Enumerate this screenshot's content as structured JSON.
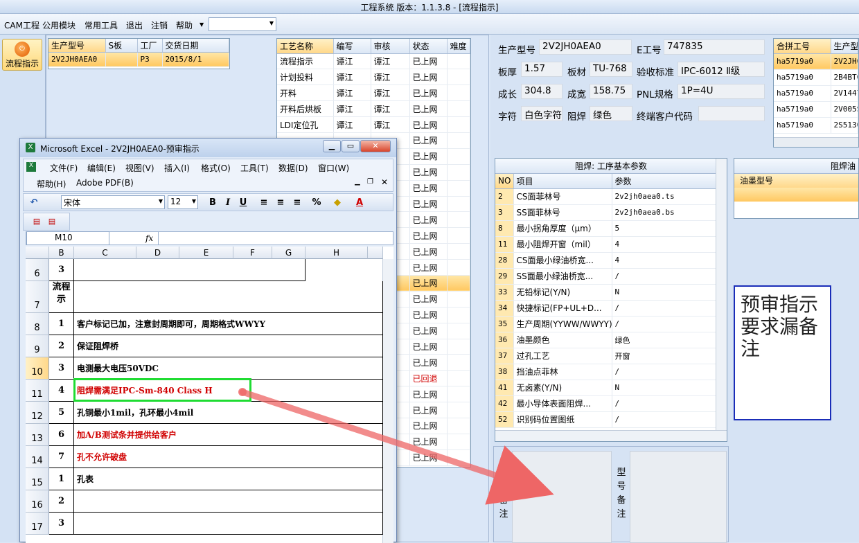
{
  "window": {
    "title": "工程系统  版本：1.1.3.8 - [流程指示]"
  },
  "menu": {
    "items": [
      "CAM工程",
      "公用模块",
      "常用工具",
      "退出",
      "注销",
      "帮助"
    ]
  },
  "nav": {
    "flow_label": "流程指示"
  },
  "order_grid": {
    "headers": [
      "生产型号",
      "S板",
      "工厂",
      "交货日期"
    ],
    "rows": [
      [
        "2V2JH0AEA0",
        "",
        "P3",
        "2015/8/1"
      ]
    ]
  },
  "process_grid": {
    "headers": [
      "工艺名称",
      "编写",
      "审核",
      "状态",
      "难度"
    ],
    "rows": [
      [
        "流程指示",
        "谭江",
        "谭江",
        "已上网",
        ""
      ],
      [
        "计划投料",
        "谭江",
        "谭江",
        "已上网",
        ""
      ],
      [
        "开料",
        "谭江",
        "谭江",
        "已上网",
        ""
      ],
      [
        "开料后烘板",
        "谭江",
        "谭江",
        "已上网",
        ""
      ],
      [
        "LDI定位孔",
        "谭江",
        "谭江",
        "已上网",
        ""
      ],
      [
        "",
        "",
        "",
        "已上网",
        ""
      ],
      [
        "",
        "",
        "",
        "已上网",
        ""
      ],
      [
        "",
        "",
        "",
        "已上网",
        ""
      ],
      [
        "",
        "",
        "",
        "已上网",
        ""
      ],
      [
        "",
        "",
        "",
        "已上网",
        ""
      ],
      [
        "",
        "",
        "",
        "已上网",
        ""
      ],
      [
        "",
        "",
        "",
        "已上网",
        ""
      ],
      [
        "",
        "",
        "",
        "已上网",
        ""
      ],
      [
        "",
        "",
        "",
        "已上网",
        ""
      ],
      [
        "",
        "",
        "",
        "已上网",
        ""
      ],
      [
        "",
        "",
        "",
        "已上网",
        ""
      ],
      [
        "",
        "",
        "",
        "已上网",
        ""
      ],
      [
        "",
        "",
        "",
        "已上网",
        ""
      ],
      [
        "",
        "",
        "",
        "已上网",
        ""
      ],
      [
        "",
        "",
        "",
        "已上网",
        ""
      ],
      [
        "",
        "",
        "",
        "已回退",
        ""
      ],
      [
        "",
        "",
        "",
        "已上网",
        ""
      ],
      [
        "",
        "",
        "",
        "已上网",
        ""
      ],
      [
        "",
        "",
        "",
        "已上网",
        ""
      ],
      [
        "",
        "",
        "",
        "已上网",
        ""
      ],
      [
        "",
        "",
        "",
        "已上网",
        ""
      ]
    ]
  },
  "info": {
    "model_label": "生产型号",
    "model": "2V2JH0AEA0",
    "e_label": "E工号",
    "e_no": "747835",
    "thick_label": "板厚",
    "thick": "1.57",
    "mat_label": "板材",
    "mat": "TU-768",
    "std_label": "验收标准",
    "std": "IPC-6012 Ⅱ级",
    "len_label": "成长",
    "len": "304.8",
    "wid_label": "成宽",
    "wid": "158.75",
    "pnl_label": "PNL规格",
    "pnl": "1P=4U",
    "char_label": "字符",
    "char": "白色字符",
    "mask_label": "阻焊",
    "mask": "绿色",
    "cust_label": "终端客户代码",
    "cust": ""
  },
  "merge_grid": {
    "headers": [
      "合拼工号",
      "生产型"
    ],
    "rows": [
      [
        "ha5719a0",
        "2V2JH0"
      ],
      [
        "ha5719a0",
        "2B4BT0"
      ],
      [
        "ha5719a0",
        "2V1447"
      ],
      [
        "ha5719a0",
        "2V005S"
      ],
      [
        "ha5719a0",
        "2S5130"
      ]
    ]
  },
  "param_grid": {
    "caption": "阻焊: 工序基本参数",
    "headers": [
      "NO",
      "项目",
      "参数"
    ],
    "rows": [
      [
        "2",
        "CS面菲林号",
        "2v2jh0aea0.ts"
      ],
      [
        "3",
        "SS面菲林号",
        "2v2jh0aea0.bs"
      ],
      [
        "8",
        "最小拐角厚度（μm）",
        "5"
      ],
      [
        "11",
        "最小阻焊开窗（mil）",
        "4"
      ],
      [
        "28",
        "CS面最小绿油桥宽...",
        "4"
      ],
      [
        "29",
        "SS面最小绿油桥宽...",
        "/"
      ],
      [
        "33",
        "无铅标记(Y/N)",
        "N"
      ],
      [
        "34",
        "快捷标记(FP+UL+D...",
        "/"
      ],
      [
        "35",
        "生产周期(YYWW/WWYY)",
        "/"
      ],
      [
        "36",
        "油墨颜色",
        "绿色"
      ],
      [
        "37",
        "过孔工艺",
        "开窗"
      ],
      [
        "38",
        "挡油点菲林",
        "/"
      ],
      [
        "41",
        "无卤素(Y/N)",
        "N"
      ],
      [
        "42",
        "最小导体表面阻焊...",
        "/"
      ],
      [
        "52",
        "识别码位置图纸",
        "/"
      ]
    ]
  },
  "ink_grid": {
    "caption": "阻焊油",
    "header": "油墨型号"
  },
  "note_box": {
    "text": "预审指示要求漏备注"
  },
  "remarks": {
    "process_label": "工艺备注",
    "model_label": "型号备注"
  },
  "excel": {
    "title": "Microsoft Excel - 2V2JH0AEA0-预审指示",
    "menu_row1": [
      "文件(F)",
      "编辑(E)",
      "视图(V)",
      "插入(I)",
      "格式(O)",
      "工具(T)",
      "数据(D)",
      "窗口(W)"
    ],
    "menu_row2": [
      "帮助(H)",
      "Adobe PDF(B)"
    ],
    "font": "宋体",
    "size": "12",
    "namebox": "M10",
    "fx": "fx",
    "cols": [
      "B",
      "C",
      "D",
      "E",
      "F",
      "G",
      "H"
    ],
    "rows": [
      {
        "n": "6",
        "b": "3",
        "c": "",
        "color": ""
      },
      {
        "n": "7",
        "b": "流程\n示",
        "c": "",
        "color": ""
      },
      {
        "n": "8",
        "b": "1",
        "c": "客户标记已加，注意封周期即可，周期格式WWYY",
        "color": ""
      },
      {
        "n": "9",
        "b": "2",
        "c": "保证阻焊桥",
        "color": ""
      },
      {
        "n": "10",
        "b": "3",
        "c": "电测最大电压50VDC",
        "color": ""
      },
      {
        "n": "11",
        "b": "4",
        "c": "阻焊需满足IPC-Sm-840 Class H",
        "color": "#d00000"
      },
      {
        "n": "12",
        "b": "5",
        "c": "孔铜最小1mil，孔环最小4mil",
        "color": ""
      },
      {
        "n": "13",
        "b": "6",
        "c": "加A/B测试条并提供给客户",
        "color": "#d00000"
      },
      {
        "n": "14",
        "b": "7",
        "c": "孔不允许破盘",
        "color": "#d00000"
      },
      {
        "n": "15",
        "b": "1",
        "c": "孔表",
        "color": ""
      },
      {
        "n": "16",
        "b": "2",
        "c": "",
        "color": ""
      },
      {
        "n": "17",
        "b": "3",
        "c": "",
        "color": ""
      }
    ]
  }
}
